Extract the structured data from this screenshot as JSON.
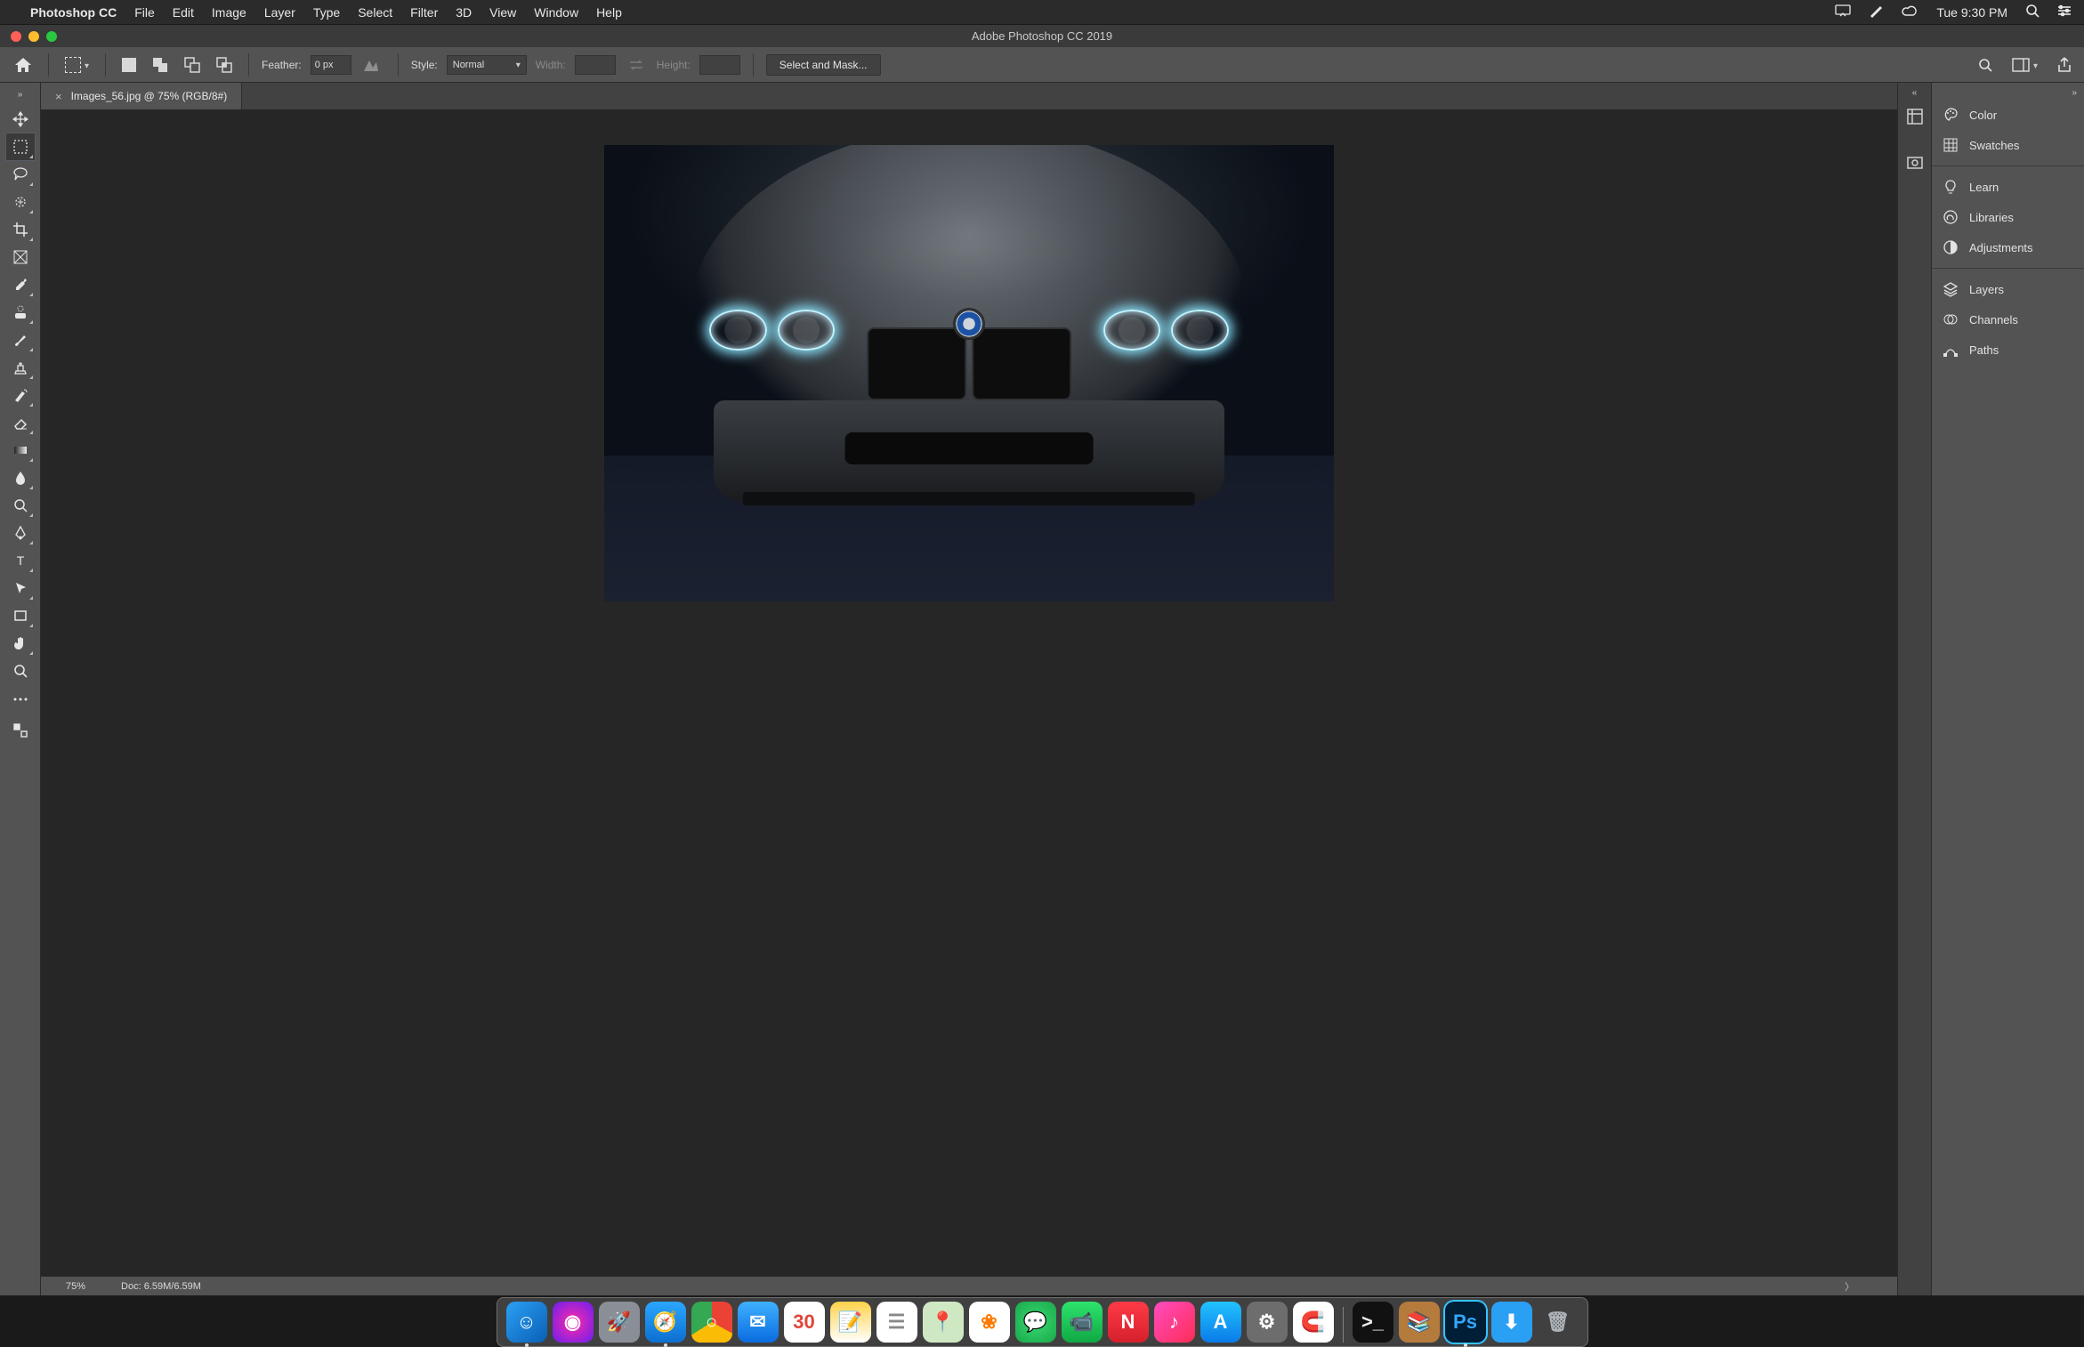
{
  "menubar": {
    "app": "Photoshop CC",
    "items": [
      "File",
      "Edit",
      "Image",
      "Layer",
      "Type",
      "Select",
      "Filter",
      "3D",
      "View",
      "Window",
      "Help"
    ],
    "clock": "Tue 9:30 PM"
  },
  "window": {
    "title": "Adobe Photoshop CC 2019"
  },
  "options": {
    "feather_label": "Feather:",
    "feather_value": "0 px",
    "style_label": "Style:",
    "style_value": "Normal",
    "width_label": "Width:",
    "width_value": "",
    "height_label": "Height:",
    "height_value": "",
    "select_mask": "Select and Mask..."
  },
  "tab": {
    "title": "Images_56.jpg @ 75% (RGB/8#)"
  },
  "tools": [
    {
      "name": "move-tool",
      "has_sub": false
    },
    {
      "name": "rectangular-marquee-tool",
      "has_sub": true,
      "active": true
    },
    {
      "name": "lasso-tool",
      "has_sub": true
    },
    {
      "name": "quick-selection-tool",
      "has_sub": true
    },
    {
      "name": "crop-tool",
      "has_sub": true
    },
    {
      "name": "frame-tool",
      "has_sub": false
    },
    {
      "name": "eyedropper-tool",
      "has_sub": true
    },
    {
      "name": "spot-healing-brush-tool",
      "has_sub": true
    },
    {
      "name": "brush-tool",
      "has_sub": true
    },
    {
      "name": "clone-stamp-tool",
      "has_sub": true
    },
    {
      "name": "history-brush-tool",
      "has_sub": true
    },
    {
      "name": "eraser-tool",
      "has_sub": true
    },
    {
      "name": "gradient-tool",
      "has_sub": true
    },
    {
      "name": "blur-tool",
      "has_sub": true
    },
    {
      "name": "dodge-tool",
      "has_sub": true
    },
    {
      "name": "pen-tool",
      "has_sub": true
    },
    {
      "name": "type-tool",
      "has_sub": true
    },
    {
      "name": "path-selection-tool",
      "has_sub": true
    },
    {
      "name": "rectangle-tool",
      "has_sub": true
    },
    {
      "name": "hand-tool",
      "has_sub": true
    },
    {
      "name": "zoom-tool",
      "has_sub": false
    }
  ],
  "panels": [
    {
      "group": 0,
      "name": "Color",
      "icon": "palette-icon"
    },
    {
      "group": 0,
      "name": "Swatches",
      "icon": "grid-icon"
    },
    {
      "group": 1,
      "name": "Learn",
      "icon": "lightbulb-icon"
    },
    {
      "group": 1,
      "name": "Libraries",
      "icon": "cc-icon"
    },
    {
      "group": 1,
      "name": "Adjustments",
      "icon": "circle-half-icon"
    },
    {
      "group": 2,
      "name": "Layers",
      "icon": "layers-icon"
    },
    {
      "group": 2,
      "name": "Channels",
      "icon": "channels-icon"
    },
    {
      "group": 2,
      "name": "Paths",
      "icon": "pen-path-icon"
    }
  ],
  "status": {
    "zoom": "75%",
    "doc": "Doc: 6.59M/6.59M"
  },
  "dock": [
    {
      "name": "finder",
      "bg": "linear-gradient(135deg,#2aa0f5,#0a5fb4)",
      "glyph": "☺",
      "running": true
    },
    {
      "name": "siri",
      "bg": "radial-gradient(circle,#ff2aa8,#6a1ef0)",
      "glyph": "◉"
    },
    {
      "name": "launchpad",
      "bg": "#8a8f97",
      "glyph": "🚀"
    },
    {
      "name": "safari",
      "bg": "linear-gradient(180deg,#2aa7ff,#0d6fd0)",
      "glyph": "🧭",
      "running": true
    },
    {
      "name": "chrome",
      "bg": "conic-gradient(#ea4335 0 33%,#fbbc05 0 66%,#34a853 0 100%)",
      "glyph": "○"
    },
    {
      "name": "mail",
      "bg": "linear-gradient(180deg,#3fb1ff,#0a6be0)",
      "glyph": "✉"
    },
    {
      "name": "calendar",
      "bg": "#fff",
      "glyph": "30",
      "text": "#e0453a"
    },
    {
      "name": "notes",
      "bg": "linear-gradient(180deg,#ffd24a,#fff)",
      "glyph": "📝"
    },
    {
      "name": "reminders",
      "bg": "#fff",
      "glyph": "☰",
      "text": "#888"
    },
    {
      "name": "maps",
      "bg": "#cfe8c4",
      "glyph": "📍"
    },
    {
      "name": "photos",
      "bg": "#fff",
      "glyph": "❀",
      "text": "#ff7a00"
    },
    {
      "name": "messages",
      "bg": "radial-gradient(circle,#38d972,#1aa84a)",
      "glyph": "💬"
    },
    {
      "name": "facetime",
      "bg": "linear-gradient(180deg,#2de36d,#10a844)",
      "glyph": "📹"
    },
    {
      "name": "news",
      "bg": "linear-gradient(180deg,#ff3b47,#d4202c)",
      "glyph": "N"
    },
    {
      "name": "music",
      "bg": "linear-gradient(135deg,#ff4cc2,#ff2d55)",
      "glyph": "♪"
    },
    {
      "name": "appstore",
      "bg": "linear-gradient(180deg,#22c3ff,#0a7be8)",
      "glyph": "A"
    },
    {
      "name": "preferences",
      "bg": "#6d6d6d",
      "glyph": "⚙"
    },
    {
      "name": "magnet",
      "bg": "#fff",
      "glyph": "🧲"
    },
    {
      "name": "divider",
      "divider": true
    },
    {
      "name": "terminal",
      "bg": "#111",
      "glyph": ">_",
      "text": "#eee"
    },
    {
      "name": "books",
      "bg": "#b57b3d",
      "glyph": "📚"
    },
    {
      "name": "photoshop",
      "bg": "#001e36",
      "glyph": "Ps",
      "text": "#31a8ff",
      "running": true,
      "active": true
    },
    {
      "name": "downloads",
      "bg": "#2aa0f5",
      "glyph": "⬇"
    },
    {
      "name": "trash",
      "bg": "transparent",
      "glyph": "🗑",
      "text": "#aeb3b9"
    }
  ]
}
